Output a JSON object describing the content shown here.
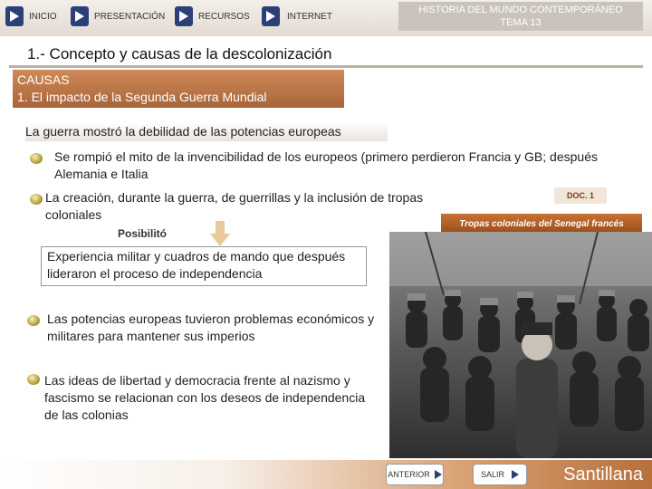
{
  "nav": {
    "inicio": "INICIO",
    "presentacion": "PRESENTACIÓN",
    "recursos": "RECURSOS",
    "internet": "INTERNET"
  },
  "header": {
    "line1": "HISTORIA DEL MUNDO CONTEMPORÁNEO",
    "line2": "TEMA 13"
  },
  "section_title": "1.- Concepto y causas de la descolonización",
  "causas": {
    "line1": "CAUSAS",
    "line2": "1. El impacto de la Segunda Guerra Mundial"
  },
  "content": {
    "intro": "La guerra mostró la debilidad de las potencias europeas",
    "bullet1": "Se rompió el mito de la invencibilidad de los europeos (primero perdieron Francia y GB; después Alemania e Italia",
    "bullet2": "La creación, durante la guerra, de guerrillas y la inclusión de tropas coloniales",
    "posibilito": "Posibilitó",
    "experiencia": "Experiencia militar y cuadros de mando que después lideraron el proceso de independencia",
    "bullet3": "Las potencias europeas tuvieron problemas económicos y militares para mantener sus imperios",
    "bullet4": "Las ideas de libertad y democracia frente al nazismo y fascismo se relacionan con los deseos de independencia de las colonias"
  },
  "doc": {
    "label": "DOC. 1",
    "caption": "Tropas coloniales del Senegal francés"
  },
  "footer": {
    "anterior": "ANTERIOR",
    "salir": "SALIR",
    "brand": "Santillana"
  },
  "colors": {
    "nav_icon": "#2b3f79",
    "accent": "#b77039",
    "causas_box": "#c07a4b"
  }
}
